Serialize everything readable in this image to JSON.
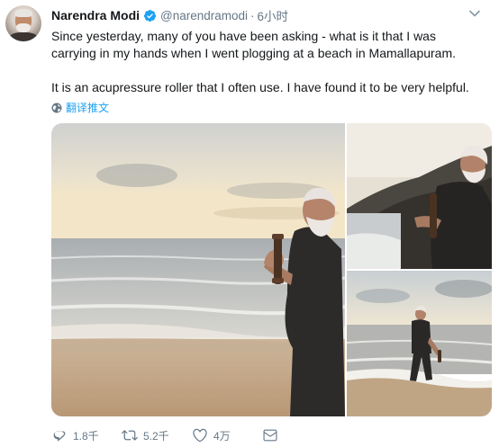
{
  "tweet": {
    "author_name": "Narendra Modi",
    "handle": "@narendramodi",
    "separator": "·",
    "time": "6小时",
    "text_paragraph_1": "Since yesterday, many of you have been asking - what is it that I was carrying in my hands when I went plogging at a beach in Mamallapuram.",
    "text_paragraph_2": "It is an acupressure roller that I often use. I have found it to be very helpful.",
    "translate_label": "翻译推文"
  },
  "actions": {
    "reply_count": "1.8千",
    "retweet_count": "5.2千",
    "like_count": "4万"
  },
  "colors": {
    "brand_blue": "#1da1f2",
    "text_primary": "#14171a",
    "text_secondary": "#657786"
  },
  "icons": [
    "avatar",
    "verified-badge-icon",
    "chevron-down-icon",
    "globe-icon",
    "reply-icon",
    "retweet-icon",
    "like-icon",
    "message-icon"
  ]
}
